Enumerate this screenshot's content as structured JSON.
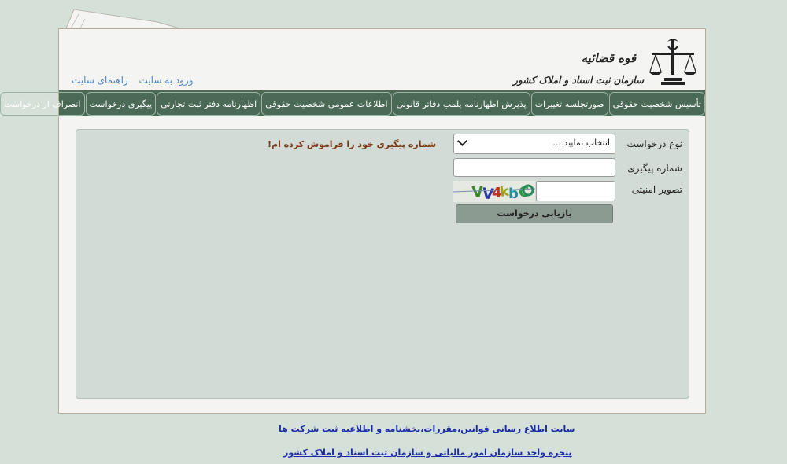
{
  "header": {
    "links": [
      "ورود به سایت",
      "راهنمای سایت"
    ],
    "logo": {
      "line1": "قوه قضائیه",
      "line2": "سازمان ثبت اسناد و املاک کشور"
    }
  },
  "nav": {
    "items": [
      "تأسیس شخصیت حقوقی",
      "صورتجلسه تغییرات",
      "پذیرش اظهارنامه پلمب دفاتر قانونی",
      "اطلاعات عمومی شخصیت حقوقی",
      "اظهارنامه دفتر ثبت تجارتی",
      "پیگیری درخواست",
      "انصراف از درخواست"
    ]
  },
  "form": {
    "request_type_label": "نوع درخواست",
    "request_type_value": "انتخاب نمایید ...",
    "tracking_label": "شماره پیگیری",
    "tracking_value": "",
    "captcha_label": "تصویر امنیتی",
    "captcha_value": "",
    "captcha_image_text": "VV4K1bCD",
    "submit_label": "بازیابی درخواست",
    "forgot_link": "شماره پیگیری خود را فراموش کرده ام!"
  },
  "footer": {
    "link1": "سایت اطلاع رسانی قوانین،مقررات،بخشنامه و اطلاعیه ثبت شرکت ها",
    "link2": "پنجره واحد سازمان امور مالیاتی و سازمان ثبت اسناد و املاک کشور"
  },
  "colors": {
    "background": "#d4e0d8",
    "navbar": "#4a6a56",
    "panel": "#d2dbd5",
    "link": "#4a84c8",
    "forgot": "#7a3a18",
    "footer_link": "#1a2aa8"
  }
}
